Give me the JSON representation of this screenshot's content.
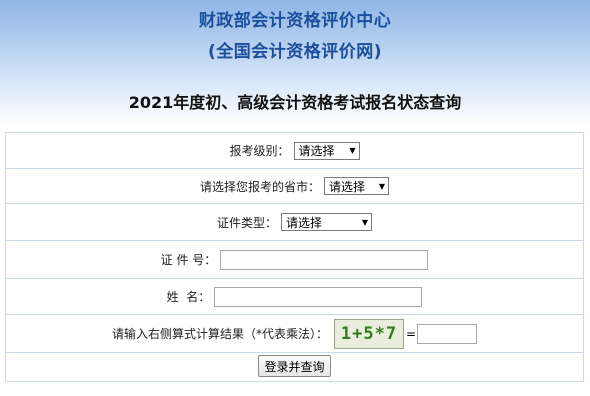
{
  "header": {
    "org_name": "财政部会计资格评价中心",
    "org_site": "(全国会计资格评价网)",
    "query_title": "2021年度初、高级会计资格考试报名状态查询"
  },
  "form": {
    "level_label": "报考级别：",
    "level_value": "请选择",
    "province_label": "请选择您报考的省市：",
    "province_value": "请选择",
    "cert_type_label": "证件类型：",
    "cert_type_value": "请选择",
    "cert_no_label": "证 件 号：",
    "cert_no_value": "",
    "name_label": "姓  名：",
    "name_value": "",
    "captcha_label": "请输入右侧算式计算结果（*代表乘法）：",
    "captcha_text": "1+5*7",
    "captcha_equals": "=",
    "captcha_answer": "",
    "submit_label": "登录并查询"
  },
  "icons": {
    "dropdown": "chevron-down-icon"
  }
}
